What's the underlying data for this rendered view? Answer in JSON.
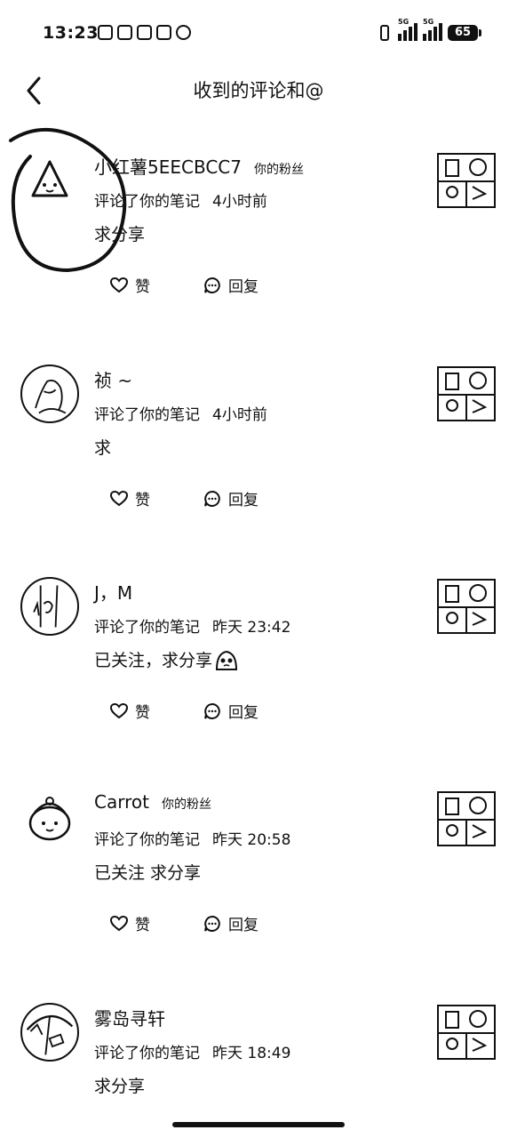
{
  "status_bar": {
    "time": "13:23",
    "network1": "5G",
    "network2": "5G",
    "battery": "65"
  },
  "header": {
    "title": "收到的评论和@"
  },
  "actions": {
    "like": "赞",
    "reply": "回复"
  },
  "comments": [
    {
      "name": "小红薯5EECBCC7",
      "fan_badge": "你的粉丝",
      "action_text": "评论了你的笔记",
      "time": "4小时前",
      "content": "求分享",
      "avatar_icon": "watermelon-avatar"
    },
    {
      "name": "祯 ~",
      "fan_badge": "",
      "action_text": "评论了你的笔记",
      "time": "4小时前",
      "content": "求",
      "avatar_icon": "sketch-person-avatar"
    },
    {
      "name": "J，M",
      "fan_badge": "",
      "action_text": "评论了你的笔记",
      "time": "昨天 23:42",
      "content": "已关注，求分享",
      "avatar_icon": "sketch-figure-avatar",
      "emoji": "pleading-emoji"
    },
    {
      "name": "Carrot",
      "fan_badge": "你的粉丝",
      "action_text": "评论了你的笔记",
      "time": "昨天 20:58",
      "content": "已关注 求分享",
      "avatar_icon": "cartoon-face-avatar"
    },
    {
      "name": "雾岛寻轩",
      "fan_badge": "",
      "action_text": "评论了你的笔记",
      "time": "昨天 18:49",
      "content": "求分享",
      "avatar_icon": "umbrella-avatar"
    }
  ]
}
